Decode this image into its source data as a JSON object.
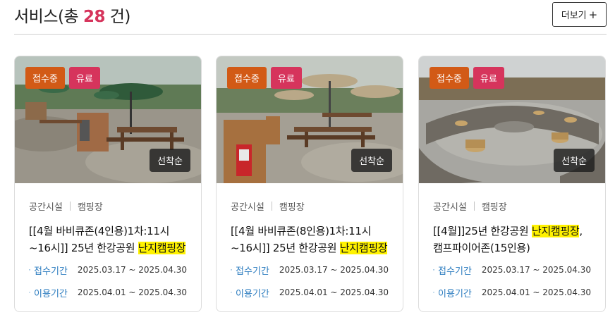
{
  "header": {
    "title_prefix": "서비스(총 ",
    "count": "28",
    "title_suffix": " 건)",
    "more_label": "더보기",
    "more_icon": "+"
  },
  "cards": [
    {
      "status": "접수중",
      "fee": "유료",
      "order": "선착순",
      "category": "공간시설",
      "subcategory": "캠핑장",
      "title_pre": "[[4월 바비큐존(4인용)1차:11시 ~16시]] 25년 한강공원 ",
      "title_hl": "난지캠핑장",
      "title_post": "",
      "reception_label": "접수기간",
      "reception_period": "2025.03.17 ~ 2025.04.30",
      "usage_label": "이용기간",
      "usage_period": "2025.04.01 ~ 2025.04.30"
    },
    {
      "status": "접수중",
      "fee": "유료",
      "order": "선착순",
      "category": "공간시설",
      "subcategory": "캠핑장",
      "title_pre": "[[4월 바비큐존(8인용)1차:11시 ~16시]] 25년 한강공원 ",
      "title_hl": "난지캠핑장",
      "title_post": "",
      "reception_label": "접수기간",
      "reception_period": "2025.03.17 ~ 2025.04.30",
      "usage_label": "이용기간",
      "usage_period": "2025.04.01 ~ 2025.04.30"
    },
    {
      "status": "접수중",
      "fee": "유료",
      "order": "선착순",
      "category": "공간시설",
      "subcategory": "캠핑장",
      "title_pre": "[[4월]]25년 한강공원 ",
      "title_hl": "난지캠핑장",
      "title_post": ", 캠프파이어존(15인용)",
      "reception_label": "접수기간",
      "reception_period": "2025.03.17 ~ 2025.04.30",
      "usage_label": "이용기간",
      "usage_period": "2025.04.01 ~ 2025.04.30"
    }
  ],
  "icons": {
    "reception": "calendar-icon",
    "usage": "clock-icon"
  },
  "colors": {
    "count": "#d6345c",
    "status_badge": "#d25a16",
    "fee_badge": "#d6345c",
    "highlight": "#fff200",
    "period_label": "#2a7bbf"
  }
}
